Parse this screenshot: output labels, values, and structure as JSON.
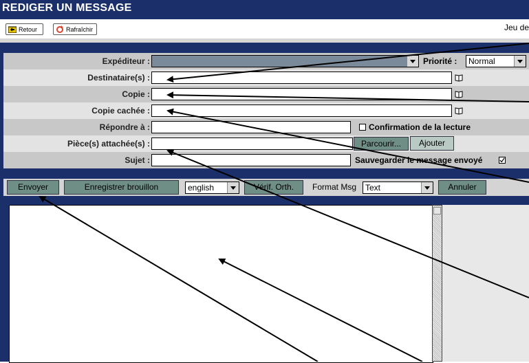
{
  "window": {
    "title": "REDIGER UN MESSAGE"
  },
  "toolbar": {
    "back_label": "Retour",
    "refresh_label": "Rafraîchir",
    "date_text": "Jeu de"
  },
  "form": {
    "sender_label": "Expéditeur :",
    "priority_label": "Priorité :",
    "priority_value": "Normal",
    "to_label": "Destinataire(s) :",
    "cc_label": "Copie :",
    "bcc_label": "Copie cachée :",
    "reply_label": "Répondre à :",
    "read_receipt_label": "Confirmation de la lecture",
    "attach_label": "Pièce(s) attachée(s) :",
    "browse_label": "Parcourir...",
    "add_label": "Ajouter",
    "subject_label": "Sujet :",
    "save_sent_label": "Sauvegarder le message envoyé"
  },
  "actions": {
    "send_label": "Envoyer",
    "save_draft_label": "Enregistrer brouillon",
    "language_value": "english",
    "spell_label": "Vérif. Orth.",
    "format_label": "Format Msg",
    "format_value": "Text",
    "cancel_label": "Annuler"
  },
  "editor": {
    "body": ""
  },
  "colors": {
    "header": "#1b2f6b",
    "button": "#6f8e86",
    "form_bg": "#c8c8c8"
  }
}
